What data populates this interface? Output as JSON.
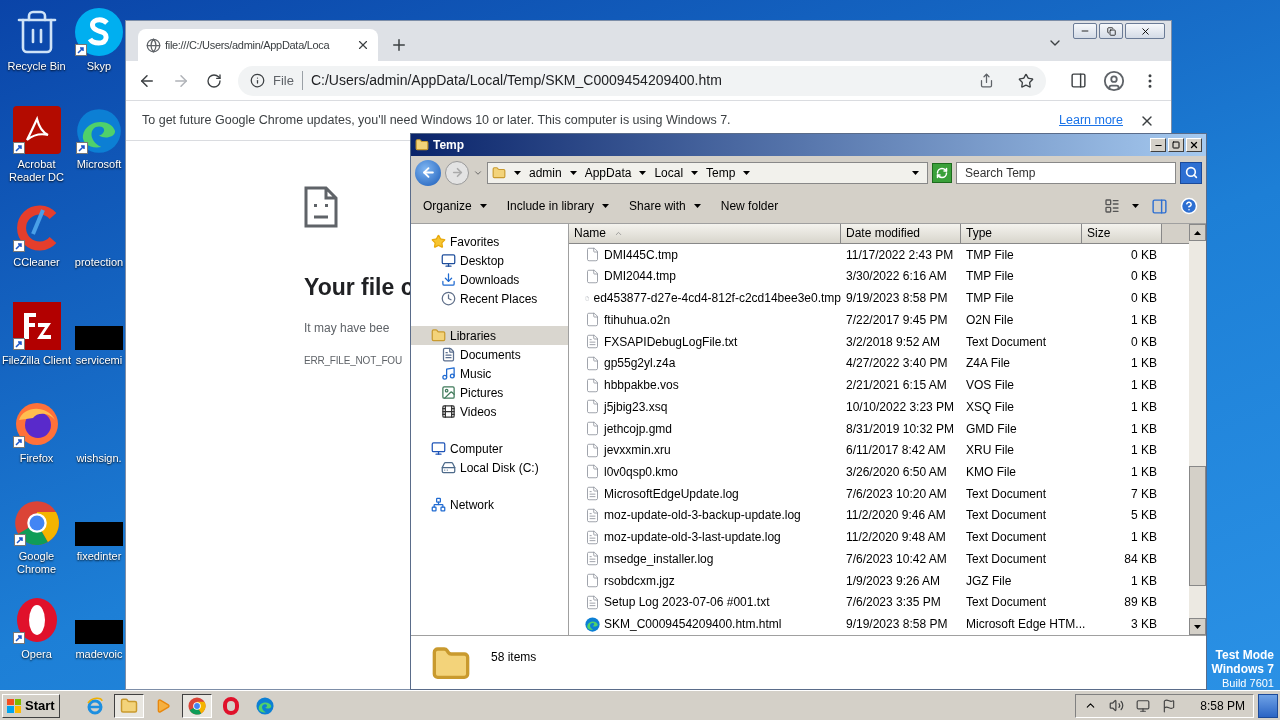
{
  "desktop": {
    "columns": [
      [
        {
          "label": "Recycle Bin",
          "kind": "recycle"
        },
        {
          "label": "Acrobat Reader DC",
          "kind": "acrobat"
        },
        {
          "label": "CCleaner",
          "kind": "ccleaner"
        },
        {
          "label": "FileZilla Client",
          "kind": "filezilla"
        },
        {
          "label": "Firefox",
          "kind": "firefox"
        },
        {
          "label": "Google Chrome",
          "kind": "chrome"
        },
        {
          "label": "Opera",
          "kind": "opera"
        }
      ],
      [
        {
          "label": "Skyp",
          "kind": "skype"
        },
        {
          "label": "Microsoft",
          "kind": "edge"
        },
        {
          "label": "protection",
          "kind": "none"
        },
        {
          "label": "servicemi",
          "kind": "thumb"
        },
        {
          "label": "wishsign.",
          "kind": "none"
        },
        {
          "label": "fixedinter",
          "kind": "thumb"
        },
        {
          "label": "madevoic",
          "kind": "thumb"
        }
      ]
    ],
    "test_mode": [
      "Test Mode",
      "Windows 7",
      "Build 7601"
    ]
  },
  "browser": {
    "tab": {
      "title": "file:///C:/Users/admin/AppData/Loca"
    },
    "address": {
      "scheme": "File",
      "url": "C:/Users/admin/AppData/Local/Temp/SKM_C0009454209400.htm"
    },
    "infobar": {
      "text": "To get future Google Chrome updates, you'll need Windows 10 or later. This computer is using Windows 7.",
      "link": "Learn more"
    },
    "error": {
      "heading": "Your file c",
      "message": "It may have bee",
      "code": "ERR_FILE_NOT_FOU"
    }
  },
  "explorer": {
    "title": "Temp",
    "breadcrumb": [
      "admin",
      "AppData",
      "Local",
      "Temp"
    ],
    "search": {
      "placeholder": "Search Temp"
    },
    "toolbar": [
      {
        "label": "Organize",
        "menu": true
      },
      {
        "label": "Include in library",
        "menu": true
      },
      {
        "label": "Share with",
        "menu": true
      },
      {
        "label": "New folder",
        "menu": false
      }
    ],
    "nav": [
      {
        "label": "Favorites",
        "kind": "star",
        "selected": false,
        "children": [
          {
            "label": "Desktop",
            "kind": "desktop",
            "selected": false
          },
          {
            "label": "Downloads",
            "kind": "downloads",
            "selected": false
          },
          {
            "label": "Recent Places",
            "kind": "recent",
            "selected": false
          }
        ]
      },
      {
        "label": "Libraries",
        "kind": "libraries",
        "selected": true,
        "children": [
          {
            "label": "Documents",
            "kind": "documents",
            "selected": false
          },
          {
            "label": "Music",
            "kind": "music",
            "selected": false
          },
          {
            "label": "Pictures",
            "kind": "pictures",
            "selected": false
          },
          {
            "label": "Videos",
            "kind": "videos",
            "selected": false
          }
        ]
      },
      {
        "label": "Computer",
        "kind": "computer",
        "selected": false,
        "children": [
          {
            "label": "Local Disk (C:)",
            "kind": "disk",
            "selected": false
          }
        ]
      },
      {
        "label": "Network",
        "kind": "network",
        "selected": false
      }
    ],
    "columns": [
      {
        "label": "Name",
        "sorted": true
      },
      {
        "label": "Date modified",
        "sorted": false
      },
      {
        "label": "Type",
        "sorted": false
      },
      {
        "label": "Size",
        "sorted": false
      }
    ],
    "files": [
      {
        "name": "DMI445C.tmp",
        "date": "11/17/2022 2:43 PM",
        "type": "TMP File",
        "size": "0 KB",
        "kind": "file"
      },
      {
        "name": "DMI2044.tmp",
        "date": "3/30/2022 6:16 AM",
        "type": "TMP File",
        "size": "0 KB",
        "kind": "file"
      },
      {
        "name": "ed453877-d27e-4cd4-812f-c2cd14bee3e0.tmp",
        "date": "9/19/2023 8:58 PM",
        "type": "TMP File",
        "size": "0 KB",
        "kind": "file"
      },
      {
        "name": "ftihuhua.o2n",
        "date": "7/22/2017 9:45 PM",
        "type": "O2N File",
        "size": "1 KB",
        "kind": "file"
      },
      {
        "name": "FXSAPIDebugLogFile.txt",
        "date": "3/2/2018 9:52 AM",
        "type": "Text Document",
        "size": "0 KB",
        "kind": "text"
      },
      {
        "name": "gp55g2yl.z4a",
        "date": "4/27/2022 3:40 PM",
        "type": "Z4A File",
        "size": "1 KB",
        "kind": "file"
      },
      {
        "name": "hbbpakbe.vos",
        "date": "2/21/2021 6:15 AM",
        "type": "VOS File",
        "size": "1 KB",
        "kind": "file"
      },
      {
        "name": "j5jbig23.xsq",
        "date": "10/10/2022 3:23 PM",
        "type": "XSQ File",
        "size": "1 KB",
        "kind": "file"
      },
      {
        "name": "jethcojp.gmd",
        "date": "8/31/2019 10:32 PM",
        "type": "GMD File",
        "size": "1 KB",
        "kind": "file"
      },
      {
        "name": "jevxxmin.xru",
        "date": "6/11/2017 8:42 AM",
        "type": "XRU File",
        "size": "1 KB",
        "kind": "file"
      },
      {
        "name": "l0v0qsp0.kmo",
        "date": "3/26/2020 6:50 AM",
        "type": "KMO File",
        "size": "1 KB",
        "kind": "file"
      },
      {
        "name": "MicrosoftEdgeUpdate.log",
        "date": "7/6/2023 10:20 AM",
        "type": "Text Document",
        "size": "7 KB",
        "kind": "text"
      },
      {
        "name": "moz-update-old-3-backup-update.log",
        "date": "11/2/2020 9:46 AM",
        "type": "Text Document",
        "size": "5 KB",
        "kind": "text"
      },
      {
        "name": "moz-update-old-3-last-update.log",
        "date": "11/2/2020 9:48 AM",
        "type": "Text Document",
        "size": "1 KB",
        "kind": "text"
      },
      {
        "name": "msedge_installer.log",
        "date": "7/6/2023 10:42 AM",
        "type": "Text Document",
        "size": "84 KB",
        "kind": "text"
      },
      {
        "name": "rsobdcxm.jgz",
        "date": "1/9/2023 9:26 AM",
        "type": "JGZ File",
        "size": "1 KB",
        "kind": "file"
      },
      {
        "name": "Setup Log 2023-07-06 #001.txt",
        "date": "7/6/2023 3:35 PM",
        "type": "Text Document",
        "size": "89 KB",
        "kind": "text"
      },
      {
        "name": "SKM_C0009454209400.htm.html",
        "date": "9/19/2023 8:58 PM",
        "type": "Microsoft Edge HTM...",
        "size": "3 KB",
        "kind": "edge"
      }
    ],
    "status": "58 items"
  },
  "taskbar": {
    "start": "Start",
    "apps": [
      {
        "kind": "ie",
        "open": false
      },
      {
        "kind": "explorer",
        "open": true
      },
      {
        "kind": "media",
        "open": false
      },
      {
        "kind": "chrome",
        "open": true
      },
      {
        "kind": "opera",
        "open": false
      },
      {
        "kind": "edge",
        "open": false
      }
    ],
    "clock": "8:58 PM"
  }
}
